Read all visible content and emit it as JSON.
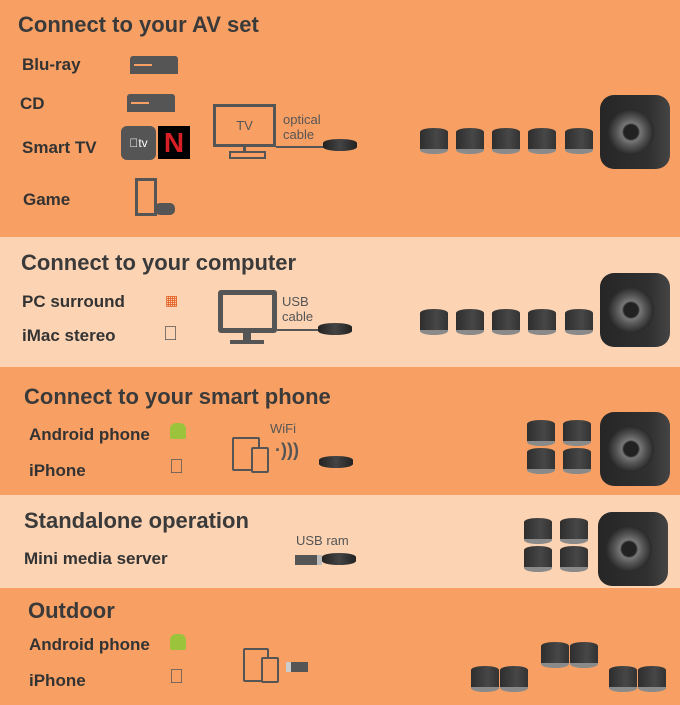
{
  "sections": [
    {
      "title": "Connect to your AV set",
      "items": [
        "Blu-ray",
        "CD",
        "Smart TV",
        "Game"
      ],
      "device_label": "TV",
      "connection": "optical cable"
    },
    {
      "title": "Connect to your computer",
      "items": [
        "PC surround",
        "iMac stereo"
      ],
      "connection": "USB cable"
    },
    {
      "title": "Connect to your smart phone",
      "items": [
        "Android phone",
        "iPhone"
      ],
      "connection": "WiFi"
    },
    {
      "title": "Standalone operation",
      "items": [
        "Mini media server"
      ],
      "connection": "USB ram"
    },
    {
      "title": "Outdoor",
      "items": [
        "Android phone",
        "iPhone"
      ]
    }
  ],
  "apple_tv_label": "tv",
  "netflix_label": "N",
  "colors": {
    "dark_band": "#f8a064",
    "light_band": "#fcd3b3",
    "android": "#9bc43c",
    "text": "#3a3a3a"
  }
}
